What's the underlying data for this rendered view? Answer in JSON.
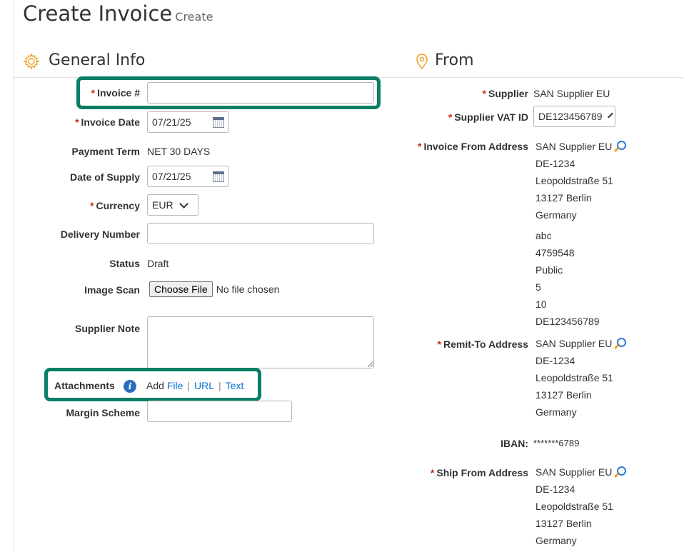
{
  "page": {
    "title": "Create Invoice",
    "subtitle": "Create"
  },
  "general": {
    "section_title": "General Info",
    "invoice_number": {
      "label": "Invoice #",
      "value": ""
    },
    "invoice_date": {
      "label": "Invoice Date",
      "value": "07/21/25"
    },
    "payment_term": {
      "label": "Payment Term",
      "value": "NET 30 DAYS"
    },
    "date_of_supply": {
      "label": "Date of Supply",
      "value": "07/21/25"
    },
    "currency": {
      "label": "Currency",
      "value": "EUR"
    },
    "delivery_number": {
      "label": "Delivery Number",
      "value": ""
    },
    "status": {
      "label": "Status",
      "value": "Draft"
    },
    "image_scan": {
      "label": "Image Scan",
      "button": "Choose File",
      "no_file": "No file chosen"
    },
    "supplier_note": {
      "label": "Supplier Note",
      "value": ""
    },
    "attachments": {
      "label": "Attachments",
      "info": "i",
      "add": "Add",
      "file": "File",
      "url": "URL",
      "text": "Text",
      "sep": "|"
    },
    "margin_scheme": {
      "label": "Margin Scheme",
      "value": ""
    }
  },
  "from": {
    "section_title": "From",
    "supplier": {
      "label": "Supplier",
      "value": "SAN Supplier EU"
    },
    "vat_id": {
      "label": "Supplier VAT ID",
      "value": "DE123456789"
    },
    "invoice_from": {
      "label": "Invoice From Address",
      "lines": [
        "SAN Supplier EU",
        "DE-1234",
        "Leopoldstraße 51",
        "13127 Berlin",
        "Germany"
      ],
      "extra": [
        "abc",
        "4759548",
        "Public",
        "5",
        "10",
        "DE123456789"
      ]
    },
    "remit_to": {
      "label": "Remit-To Address",
      "lines": [
        "SAN Supplier EU",
        "DE-1234",
        "Leopoldstraße 51",
        "13127 Berlin",
        "Germany"
      ]
    },
    "iban": {
      "label": "IBAN:",
      "value": "*******6789"
    },
    "ship_from": {
      "label": "Ship From Address",
      "lines": [
        "SAN Supplier EU",
        "DE-1234",
        "Leopoldstraße 51",
        "13127 Berlin",
        "Germany"
      ]
    }
  },
  "required_mark": "*",
  "icons": {
    "gear": "gear-icon",
    "location": "location-pin-icon",
    "calendar": "calendar-icon",
    "search": "search-icon",
    "info": "info-icon"
  },
  "colors": {
    "required": "#d0271d",
    "link": "#0a6ed1",
    "highlight": "#0a7e67",
    "icon_orange": "#f0a020"
  }
}
